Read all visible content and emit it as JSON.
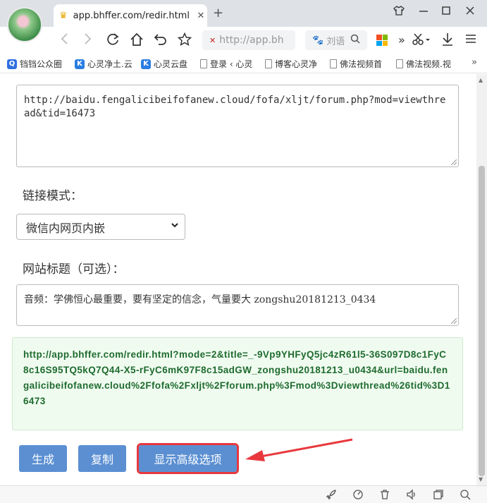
{
  "browser": {
    "tab_title": "app.bhffer.com/redir.html",
    "tab_close": "✕",
    "new_tab": "+",
    "window_controls": {
      "tshirt": "⌂",
      "minimize": "—",
      "maximize": "☐",
      "close": "✕"
    },
    "address": "http://app.bh",
    "search_placeholder": "刘语",
    "toolbar_more": "»",
    "bookmarks": [
      {
        "label": "铛铛公众圈",
        "icon": "q-icon"
      },
      {
        "label": "心灵净土.云",
        "icon": "k-icon"
      },
      {
        "label": "心灵云盘",
        "icon": "k-icon"
      },
      {
        "label": "登录 ‹ 心灵",
        "icon": "doc-icon"
      },
      {
        "label": "博客心灵净",
        "icon": "doc-icon"
      },
      {
        "label": "佛法视频首",
        "icon": "doc-icon"
      },
      {
        "label": "佛法视频.视",
        "icon": "doc-icon"
      }
    ],
    "bookmarks_more": "»"
  },
  "form": {
    "source_url": "http://baidu.fengalicibeifofanew.cloud/fofa/xljt/forum.php?mod=viewthread&tid=16473",
    "link_mode_label": "链接模式：",
    "link_mode_value": "微信内网页内嵌",
    "site_title_label": "网站标题（可选）：",
    "site_title_value": "音频：学佛恒心最重要，要有坚定的信念，气量要大 zongshu20181213_0434",
    "result_url": "http://app.bhffer.com/redir.html?mode=2&title=_-9Vp9YHFyQ5jc4zR61l5-36S097D8c1FyC8c16S95TQ5kQ7Q44-X5-rFyC6mK97F8c15adGW_zongshu20181213_u0434&url=baidu.fengalicibeifofanew.cloud%2Ffofa%2Fxljt%2Fforum.php%3Fmod%3Dviewthread%26tid%3D16473",
    "buttons": {
      "generate": "生成",
      "copy": "复制",
      "advanced": "显示高级选项"
    }
  },
  "colors": {
    "button_blue": "#5b8fd2",
    "highlight_red": "#e8383d",
    "result_green_text": "#1e6b2e",
    "result_green_bg": "#f0fbf0"
  }
}
